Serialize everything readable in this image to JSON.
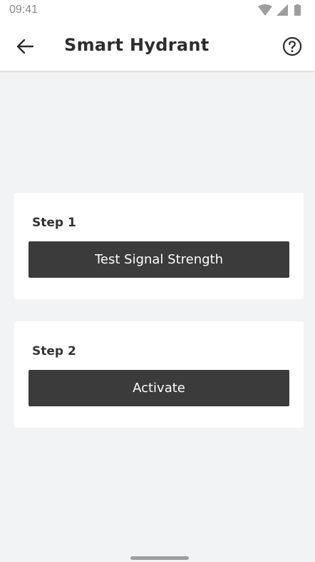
{
  "status_bar": {
    "time": "09:41",
    "icons": [
      "wifi-icon",
      "cellular-signal-icon",
      "battery-icon"
    ]
  },
  "app_bar": {
    "back_icon": "arrow-left-icon",
    "title": "Smart Hydrant",
    "help_icon": "help-circle-icon"
  },
  "steps": [
    {
      "label": "Step 1",
      "button_label": "Test Signal Strength"
    },
    {
      "label": "Step 2",
      "button_label": "Activate"
    }
  ],
  "colors": {
    "background": "#f2f3f5",
    "card": "#ffffff",
    "button": "#3b3b3b",
    "button_text": "#ffffff",
    "title_text": "#2d2d2d"
  }
}
